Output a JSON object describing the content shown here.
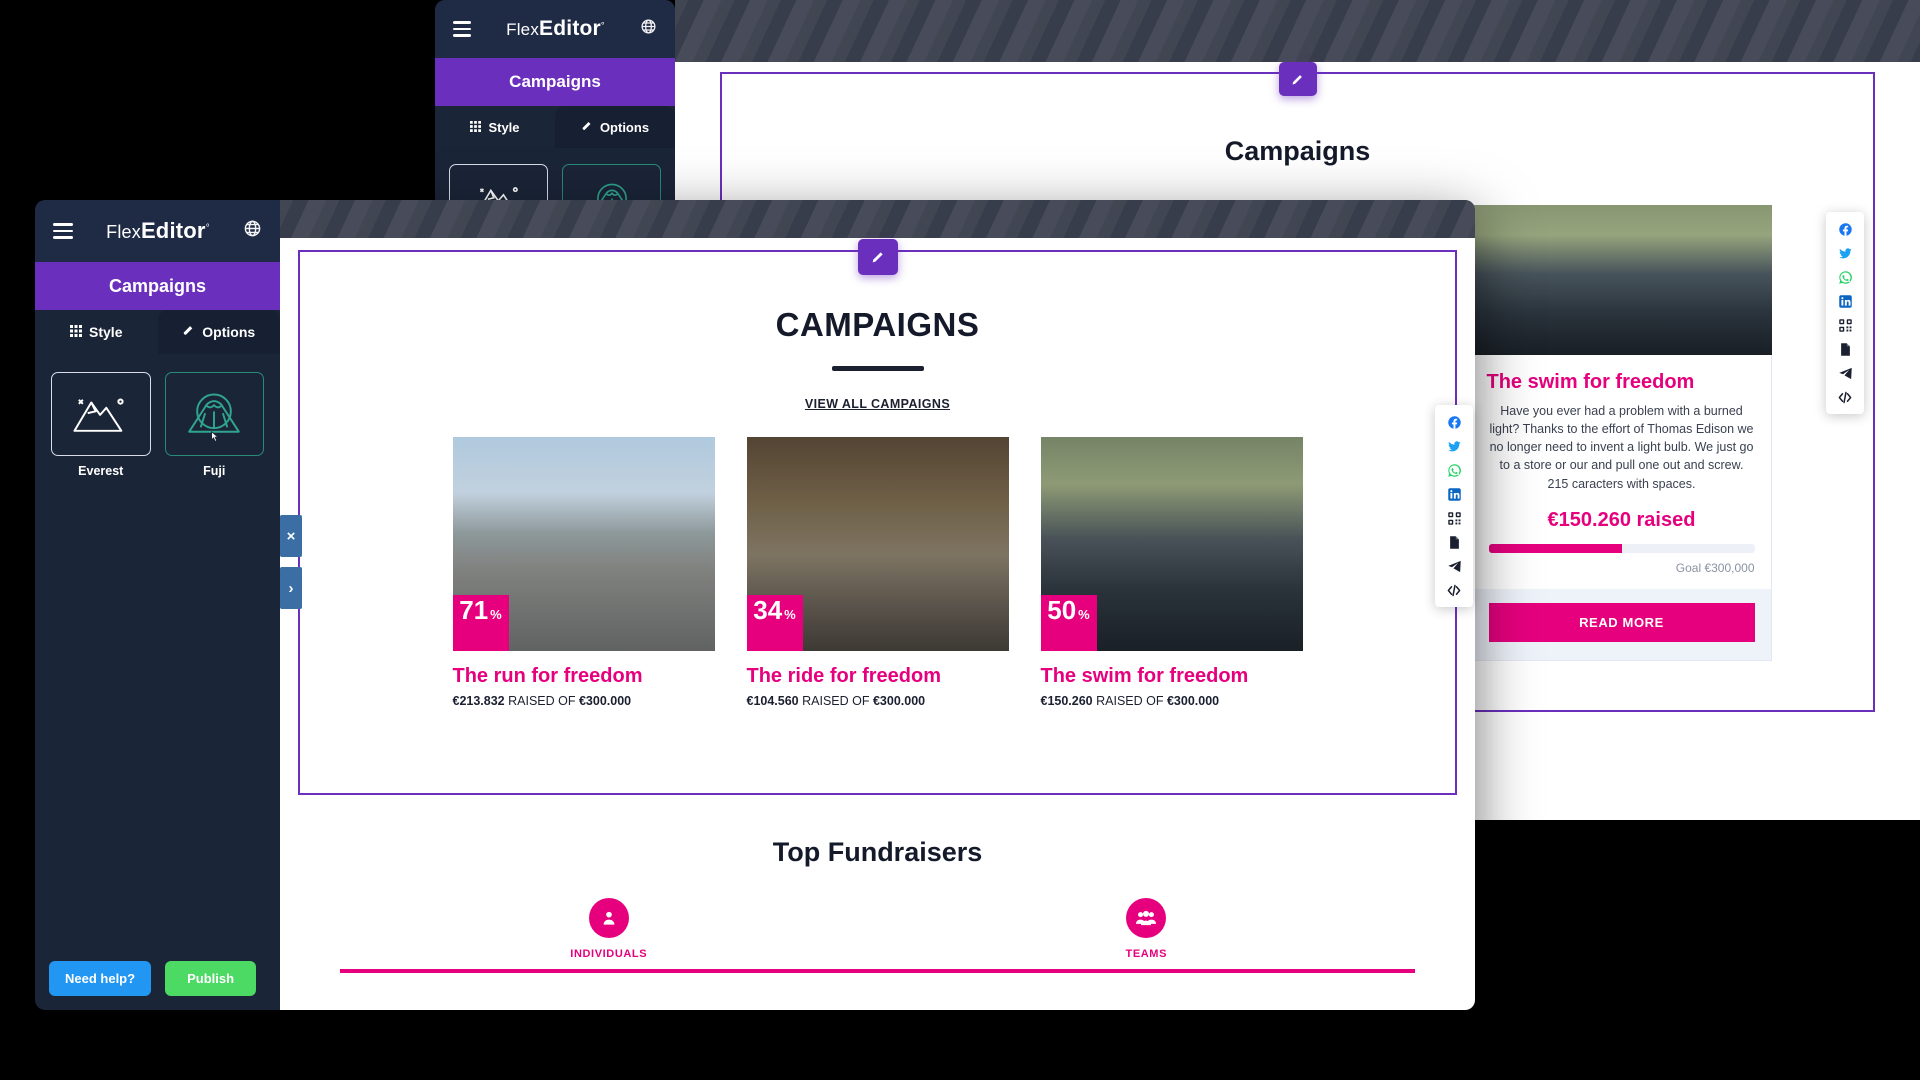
{
  "app": {
    "brand_flex": "Flex",
    "brand_editor": "Editor",
    "brand_degree": "°",
    "menu_icon": "hamburger-icon",
    "globe_icon": "globe-icon"
  },
  "editor": {
    "section_title": "Campaigns",
    "tabs": [
      {
        "label": "Style",
        "icon": "grid-icon"
      },
      {
        "label": "Options",
        "icon": "brush-icon"
      }
    ],
    "styles": [
      {
        "label": "Everest",
        "icon": "mountain-peaks-icon",
        "selected": true
      },
      {
        "label": "Fuji",
        "icon": "mount-fuji-icon",
        "selected": false
      }
    ],
    "footer": {
      "help_label": "Need help?",
      "publish_label": "Publish",
      "help_color": "#2196f3",
      "publish_color": "#4cd964"
    },
    "handles": {
      "close": "×",
      "expand": "›"
    }
  },
  "canvas_front": {
    "edit_icon": "pencil-icon",
    "section_title": "CAMPAIGNS",
    "view_all_label": "VIEW ALL CAMPAIGNS",
    "cards": [
      {
        "percent": "71",
        "percent_symbol": "%",
        "title": "The run for freedom",
        "raised": "€213.832",
        "middle": "RAISED OF",
        "goal": "€300.000",
        "photo": "runners-on-trail"
      },
      {
        "percent": "34",
        "percent_symbol": "%",
        "title": "The ride for freedom",
        "raised": "€104.560",
        "middle": "RAISED OF",
        "goal": "€300.000",
        "photo": "cyclist-on-road"
      },
      {
        "percent": "50",
        "percent_symbol": "%",
        "title": "The swim for freedom",
        "raised": "€150.260",
        "middle": "RAISED OF",
        "goal": "€300.000",
        "photo": "swimmers-with-yellow-caps"
      }
    ],
    "fundraisers": {
      "title": "Top Fundraisers",
      "tabs": [
        {
          "label": "INDIVIDUALS",
          "icon": "person-icon"
        },
        {
          "label": "TEAMS",
          "icon": "people-group-icon"
        }
      ]
    }
  },
  "canvas_back": {
    "edit_icon": "pencil-icon",
    "section_title": "Campaigns"
  },
  "detail": {
    "title": "The swim for freedom",
    "body": "Have you ever had a problem with a burned light? Thanks to the effort of Thomas Edison we no longer need to invent a light bulb. We just go to a store or our and pull one out and screw. 215 caracters with spaces.",
    "raised_label": "€150.260 raised",
    "progress_percent": 50,
    "goal_label": "Goal €300,000",
    "read_more_label": "READ MORE"
  },
  "social": {
    "items": [
      {
        "name": "facebook-icon",
        "color": "#1877f2"
      },
      {
        "name": "twitter-icon",
        "color": "#1da1f2"
      },
      {
        "name": "whatsapp-icon",
        "color": "#25d366"
      },
      {
        "name": "linkedin-icon",
        "color": "#0a66c2"
      },
      {
        "name": "qr-code-icon",
        "color": "#1b2030"
      },
      {
        "name": "document-icon",
        "color": "#1b2030"
      },
      {
        "name": "telegram-send-icon",
        "color": "#1b2030"
      },
      {
        "name": "embed-code-icon",
        "color": "#1b2030"
      }
    ]
  },
  "colors": {
    "accent_pink": "#e6007e",
    "accent_purple": "#6b2fbd",
    "panel_dark": "#1b2538",
    "panel_top": "#1f2a44"
  }
}
